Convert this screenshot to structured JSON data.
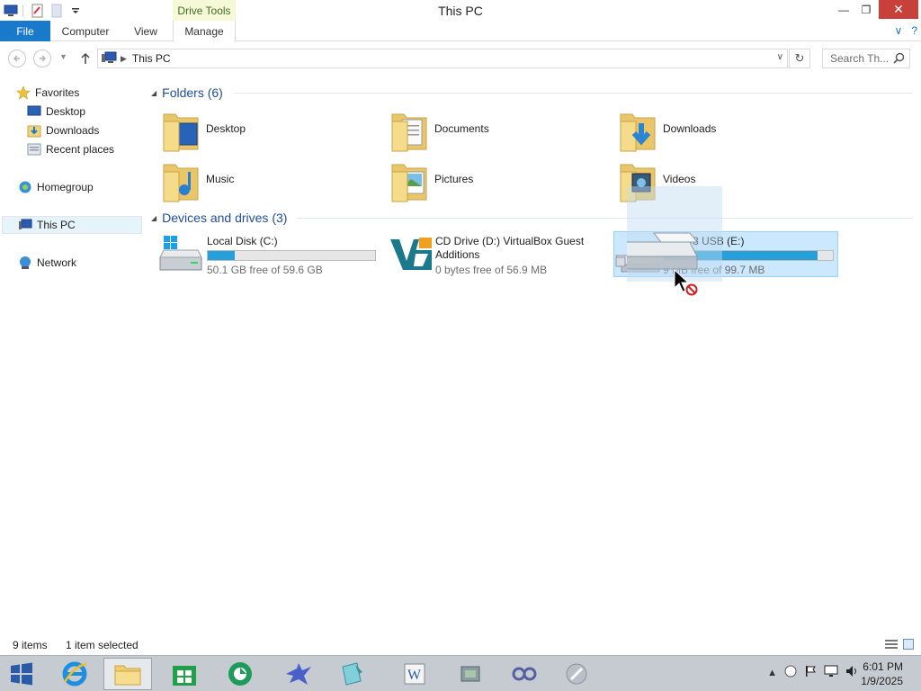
{
  "window": {
    "title": "This PC",
    "contextual_tab_group": "Drive Tools",
    "controls": {
      "minimize": "—",
      "restore": "❐",
      "close": "✕"
    }
  },
  "ribbon": {
    "tabs": [
      "File",
      "Computer",
      "View",
      "Manage"
    ],
    "help": "?",
    "collapse": "∨"
  },
  "address_bar": {
    "location": "This PC",
    "search_placeholder": "Search Th..."
  },
  "nav_pane": {
    "favorites": {
      "label": "Favorites",
      "items": [
        "Desktop",
        "Downloads",
        "Recent places"
      ]
    },
    "homegroup": "Homegroup",
    "this_pc": "This PC",
    "network": "Network"
  },
  "folders": {
    "header": "Folders (6)",
    "items": [
      "Desktop",
      "Documents",
      "Downloads",
      "Music",
      "Pictures",
      "Videos"
    ]
  },
  "devices": {
    "header": "Devices and drives (3)",
    "items": [
      {
        "name": "Local Disk (C:)",
        "free": "50.1 GB free of 59.6 GB",
        "used_fraction": 0.16
      },
      {
        "name_line1": "CD Drive (D:) VirtualBox Guest",
        "name_line2": "Additions",
        "free": "0 bytes free of 56.9 MB"
      },
      {
        "name": "FAST 3 USB (E:)",
        "free": "9 MB free of 99.7 MB",
        "used_fraction": 0.91
      }
    ]
  },
  "status": {
    "count": "9 items",
    "selection": "1 item selected"
  },
  "taskbar": {
    "time": "6:01 PM",
    "date": "1/9/2025"
  },
  "colors": {
    "accent": "#1979ca",
    "selection": "#cce8ff",
    "bar_fill": "#26a0da",
    "close": "#c7403a"
  }
}
